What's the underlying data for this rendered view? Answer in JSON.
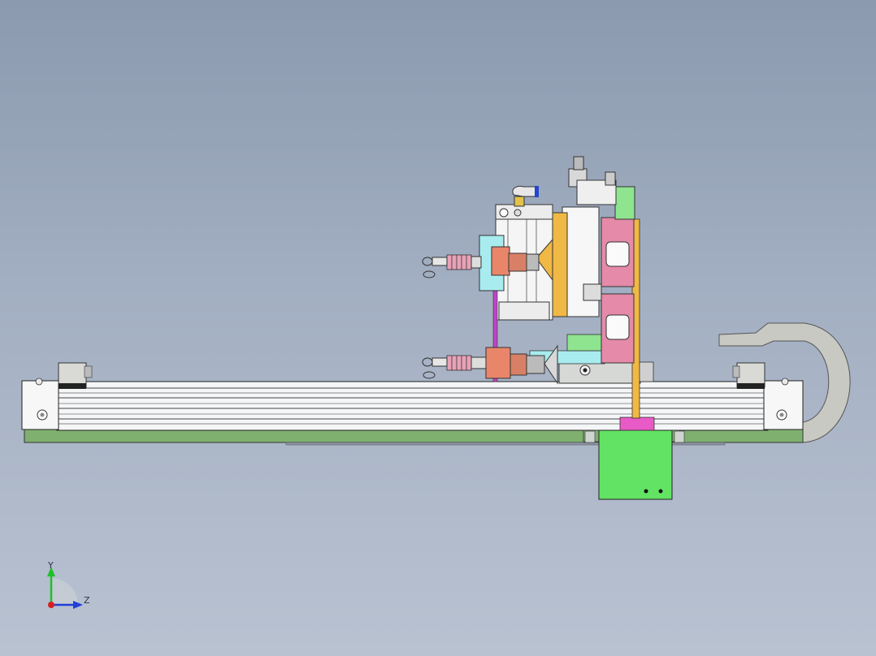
{
  "viewport": {
    "background_top": "#8b9aaf",
    "background_bottom": "#b9c2d1"
  },
  "triad": {
    "y_label": "Y",
    "z_label": "Z",
    "y_color": "#1fbf2a",
    "z_color": "#1f3fd8",
    "x_color": "#d81f1f"
  },
  "colors": {
    "base_plate": "#7fb070",
    "rail_white": "#f4f6f7",
    "lime": "#63e363",
    "pink": "#e58aa9",
    "magenta": "#c044c8",
    "orange": "#f0b845",
    "copper": "#e9866a",
    "cyan": "#a8ecef",
    "cable_gray": "#c9c9c4"
  }
}
